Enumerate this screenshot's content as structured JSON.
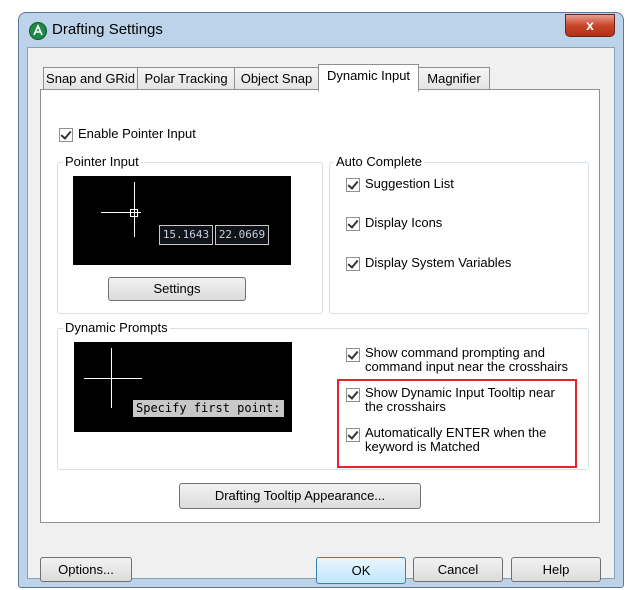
{
  "window": {
    "title": "Drafting Settings",
    "close_glyph": "x"
  },
  "tabs": [
    {
      "label": "Snap and GRid"
    },
    {
      "label": "Polar Tracking"
    },
    {
      "label": "Object Snap"
    },
    {
      "label": "Dynamic Input"
    },
    {
      "label": "Magnifier"
    }
  ],
  "active_tab": "Dynamic Input",
  "pointer_input": {
    "enable_label": "Enable Pointer Input",
    "enabled": true,
    "group_label": "Pointer Input",
    "coord_x": "15.1643",
    "coord_y": "22.0669",
    "settings_button": "Settings"
  },
  "auto_complete": {
    "group_label": "Auto Complete",
    "options": [
      {
        "label": "Suggestion List",
        "checked": true
      },
      {
        "label": "Display Icons",
        "checked": true
      },
      {
        "label": "Display System Variables",
        "checked": true
      }
    ]
  },
  "dynamic_prompts": {
    "group_label": "Dynamic Prompts",
    "preview_text": "Specify first point:",
    "options": [
      {
        "line1": "Show command prompting and",
        "line2": "command input near the crosshairs",
        "checked": true
      },
      {
        "line1": "Show Dynamic Input Tooltip near",
        "line2": "the crosshairs",
        "checked": true
      },
      {
        "line1": "Automatically ENTER when the",
        "line2": "keyword is Matched",
        "checked": true
      }
    ],
    "highlight_color": "#e0262b"
  },
  "tooltip_button": "Drafting Tooltip Appearance...",
  "footer": {
    "options_button": "Options...",
    "ok_button": "OK",
    "cancel_button": "Cancel",
    "help_button": "Help"
  }
}
